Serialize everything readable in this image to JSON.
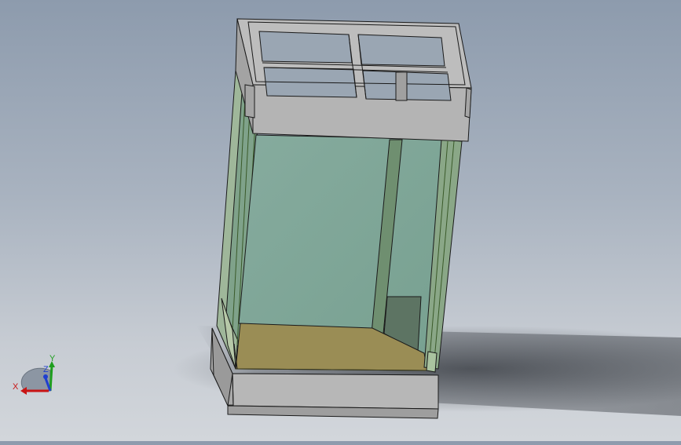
{
  "viewport": {
    "background_top": "#8d9bad",
    "background_bottom": "#d2d6db"
  },
  "model": {
    "frame_color": "#b9b9b9",
    "frame_edge": "#1a1a1a",
    "glass_color": "#7fa89a",
    "floor_color": "#9a8d55",
    "post_color": "#6f8f70"
  },
  "triad": {
    "x_label": "X",
    "y_label": "Y",
    "z_label": "Z",
    "x_color": "#c81414",
    "y_color": "#1e9e1e",
    "z_color": "#1f3fcf"
  }
}
